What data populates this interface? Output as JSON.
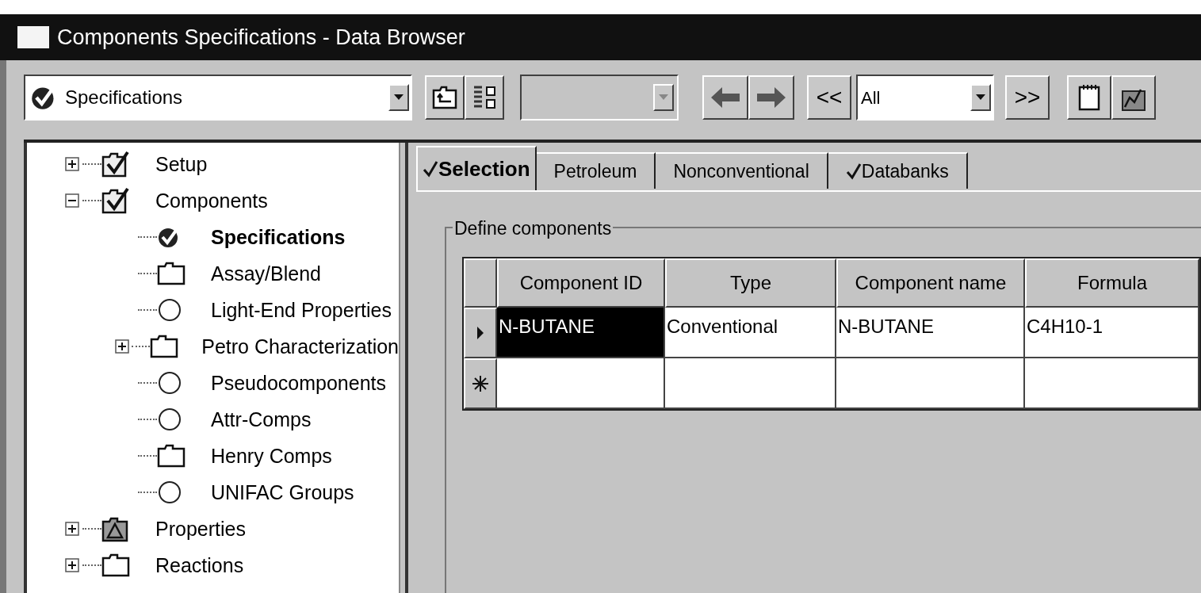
{
  "window": {
    "title": "Components Specifications - Data Browser"
  },
  "toolbar": {
    "form_select": {
      "value": "Specifications"
    },
    "empty_select": {
      "disabled": true
    },
    "prev_label": "<<",
    "filter_select": {
      "value": "All"
    },
    "next_label": ">>"
  },
  "tree": [
    {
      "label": "Setup",
      "kind": "checked-folder",
      "expanded": false,
      "selected": false
    },
    {
      "label": "Components",
      "kind": "checked-folder",
      "expanded": true,
      "selected": false,
      "children": [
        {
          "label": "Specifications",
          "kind": "checked-circle",
          "selected": true
        },
        {
          "label": "Assay/Blend",
          "kind": "folder",
          "selected": false
        },
        {
          "label": "Light-End Properties",
          "kind": "circle",
          "selected": false
        },
        {
          "label": "Petro Characterization",
          "kind": "folder",
          "expanded": false,
          "selected": false
        },
        {
          "label": "Pseudocomponents",
          "kind": "circle",
          "selected": false
        },
        {
          "label": "Attr-Comps",
          "kind": "circle",
          "selected": false
        },
        {
          "label": "Henry Comps",
          "kind": "folder",
          "selected": false
        },
        {
          "label": "UNIFAC Groups",
          "kind": "circle",
          "selected": false
        }
      ]
    },
    {
      "label": "Properties",
      "kind": "warning-folder",
      "expanded": false,
      "selected": false
    },
    {
      "label": "Reactions",
      "kind": "folder",
      "expanded": false,
      "selected": false
    }
  ],
  "tabs": [
    {
      "label": "Selection",
      "selected": true,
      "complete": true
    },
    {
      "label": "Petroleum",
      "selected": false,
      "complete": false
    },
    {
      "label": "Nonconventional",
      "selected": false,
      "complete": false
    },
    {
      "label": "Databanks",
      "selected": false,
      "complete": true
    }
  ],
  "group": {
    "title": "Define components"
  },
  "table": {
    "columns": [
      "Component ID",
      "Type",
      "Component name",
      "Formula"
    ],
    "rows": [
      {
        "kind": "current",
        "cells": [
          {
            "text": "N-BUTANE",
            "selected": true
          },
          {
            "text": "Conventional",
            "selected": false
          },
          {
            "text": "N-BUTANE",
            "selected": false
          },
          {
            "text": "C4H10-1",
            "selected": false
          }
        ]
      },
      {
        "kind": "new"
      }
    ]
  }
}
